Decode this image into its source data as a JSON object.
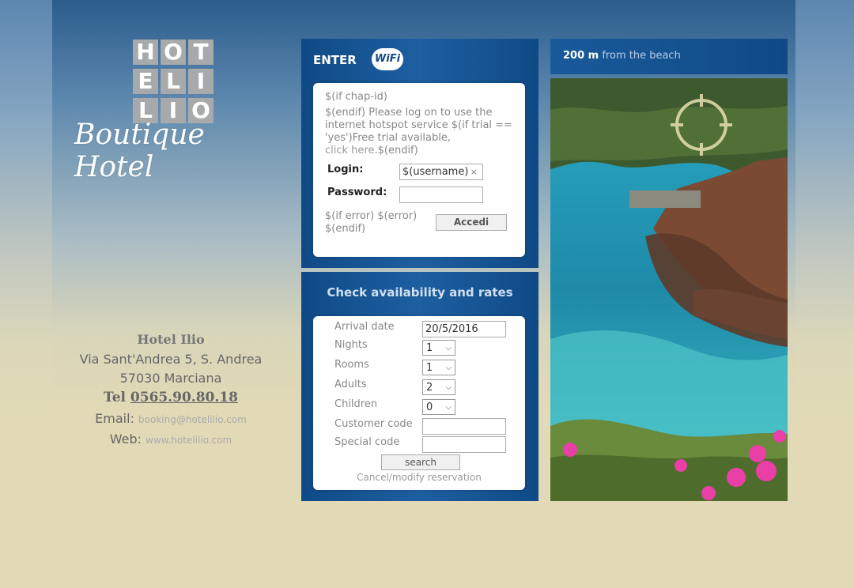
{
  "logo": {
    "tiles": [
      "H",
      "O",
      "T",
      "E",
      "L",
      "I",
      "L",
      "I",
      "O"
    ],
    "script": "Boutique Hotel"
  },
  "address": {
    "name": "Hotel Ilio",
    "street": "Via Sant'Andrea 5, S. Andrea",
    "city": "57030 Marciana",
    "tel_label": "Tel",
    "tel": "0565.90.80.18",
    "email_label": "Email:",
    "email": "booking@hotelilio.com",
    "web_label": "Web:",
    "web": "www.hotelilio.com"
  },
  "login": {
    "header": "ENTER",
    "wifi_label": "WiFi",
    "line1": "$(if chap-id)",
    "line2": "$(endif) Please log on to use the internet hotspot service $(if trial == 'yes')Free trial available,",
    "click_here": "click here",
    "line3": ".$(endif)",
    "login_label": "Login:",
    "username_value": "$(username)",
    "password_label": "Password:",
    "error_text": "$(if error) $(error) $(endif)",
    "button": "Accedi"
  },
  "availability": {
    "title": "Check availability and rates",
    "arrival_label": "Arrival date",
    "arrival_value": "20/5/2016",
    "nights_label": "Nights",
    "nights_value": "1",
    "rooms_label": "Rooms",
    "rooms_value": "1",
    "adults_label": "Adults",
    "adults_value": "2",
    "children_label": "Children",
    "children_value": "0",
    "customer_code_label": "Customer code",
    "special_code_label": "Special code",
    "search_button": "search",
    "cancel_link": "Cancel/modify reservation"
  },
  "beach": {
    "distance": "200 m",
    "suffix": "from the beach"
  },
  "colors": {
    "panel_blue": "#0f4a86",
    "page_bg": "#e2dab6"
  }
}
